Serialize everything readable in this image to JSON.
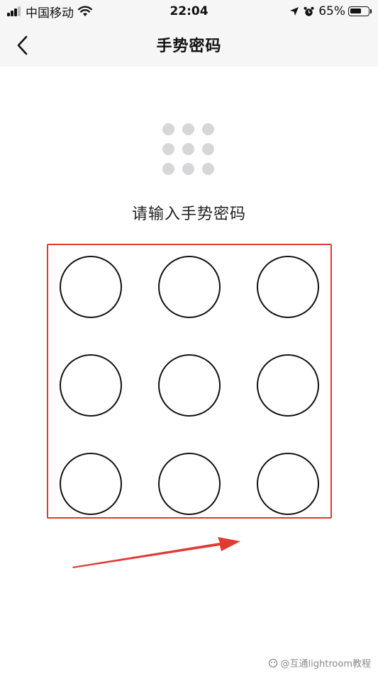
{
  "status_bar": {
    "carrier": "中国移动",
    "time": "22:04",
    "battery_percent": "65%",
    "battery_level": 0.65,
    "icons": [
      "signal-icon",
      "wifi-icon",
      "location-icon",
      "alarm-icon",
      "battery-icon"
    ]
  },
  "nav": {
    "title": "手势密码",
    "back_icon": "chevron-left-icon"
  },
  "gesture_icon": "nine-dot-grid-icon",
  "prompt": "请输入手势密码",
  "pattern": {
    "rows": 3,
    "cols": 3,
    "highlight_color": "#e03a32"
  },
  "annotation": {
    "arrow_color": "#e03a32"
  },
  "watermark": {
    "text": "@互通lightroom教程",
    "icon": "watermark-logo-icon"
  }
}
